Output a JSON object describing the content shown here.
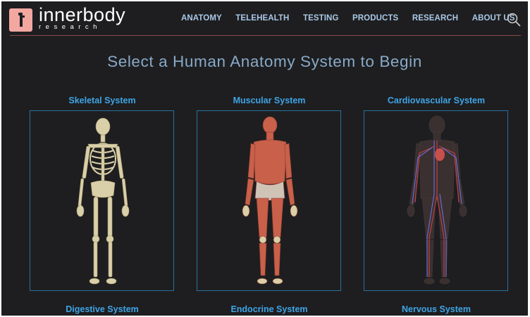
{
  "brand": {
    "name": "innerbody",
    "tagline": "research"
  },
  "nav": {
    "items": [
      "ANATOMY",
      "TELEHEALTH",
      "TESTING",
      "PRODUCTS",
      "RESEARCH",
      "ABOUT US"
    ],
    "search_icon": "search-icon"
  },
  "main": {
    "title": "Select a Human Anatomy System to Begin",
    "systems": [
      {
        "label": "Skeletal System"
      },
      {
        "label": "Muscular System"
      },
      {
        "label": "Cardiovascular System"
      },
      {
        "label": "Digestive System"
      },
      {
        "label": "Endocrine System"
      },
      {
        "label": "Nervous System"
      }
    ]
  },
  "colors": {
    "background": "#1e1e20",
    "nav_text": "#a9c8e6",
    "title": "#88a9c8",
    "link": "#3ea5e6",
    "card_border": "#2b6f9e",
    "logo": "#f3a7a1"
  }
}
